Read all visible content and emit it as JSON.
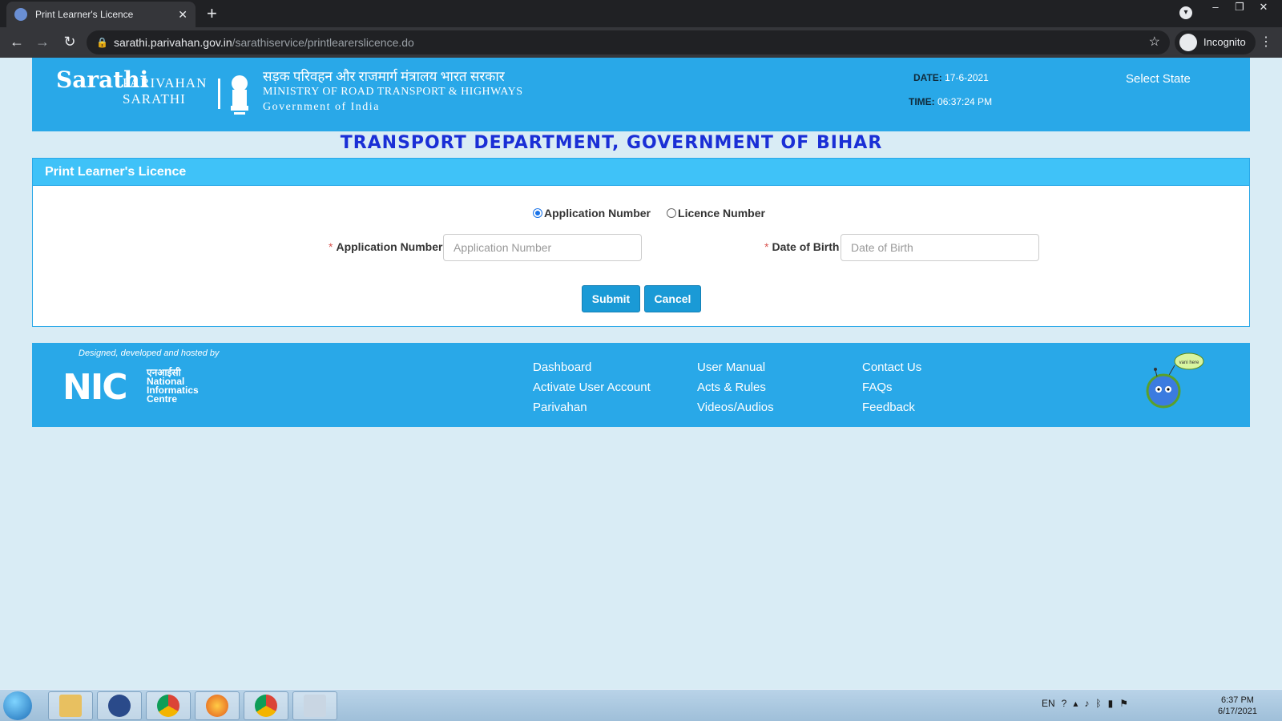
{
  "browser": {
    "tab_title": "Print Learner's Licence",
    "new_tab": "+",
    "url_host": "sarathi.parivahan.gov.in",
    "url_path": "/sarathiservice/printlearerslicence.do",
    "incognito_label": "Incognito"
  },
  "header": {
    "logo_text": "Sarathi",
    "brand_line1": "PARIVAHAN",
    "brand_line2": "SARATHI",
    "ministry_hindi": "सड़क परिवहन और राजमार्ग मंत्रालय भारत सरकार",
    "ministry_english": "MINISTRY OF ROAD TRANSPORT & HIGHWAYS",
    "government": "Government of India",
    "date_label": "DATE:",
    "date_value": "17-6-2021",
    "time_label": "TIME:",
    "time_value": "06:37:24 PM",
    "select_state": "Select State"
  },
  "department_title": "TRANSPORT DEPARTMENT, GOVERNMENT OF BIHAR",
  "form": {
    "panel_title": "Print Learner's Licence",
    "radio_application": "Application Number",
    "radio_licence": "Licence Number",
    "app_number_label": "Application Number",
    "app_number_placeholder": "Application Number",
    "dob_label": "Date of Birth",
    "dob_placeholder": "Date of Birth",
    "required_mark": "*",
    "submit": "Submit",
    "cancel": "Cancel"
  },
  "footer": {
    "designed_by": "Designed, developed and hosted by",
    "nic_letters": "NIC",
    "nic_hindi": "एनआईसी",
    "nic_line1": "National",
    "nic_line2": "Informatics",
    "nic_line3": "Centre",
    "links_col1": [
      "Dashboard",
      "Activate User Account",
      "Parivahan"
    ],
    "links_col2": [
      "User Manual",
      "Acts & Rules",
      "Videos/Audios"
    ],
    "links_col3": [
      "Contact Us",
      "FAQs",
      "Feedback"
    ],
    "mascot_bubble": "vani here"
  },
  "taskbar": {
    "lang": "EN",
    "time": "6:37 PM",
    "date": "6/17/2021"
  }
}
